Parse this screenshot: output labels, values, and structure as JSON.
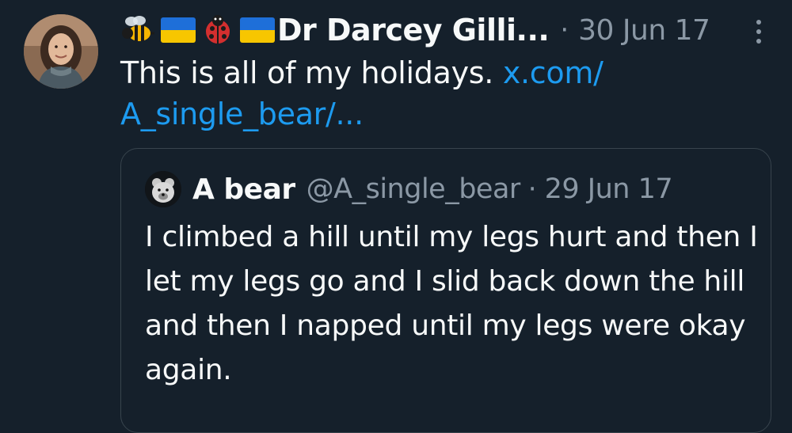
{
  "tweet": {
    "author": {
      "display_name": "Dr Darcey Gilli...",
      "name_emojis": [
        "bee-icon",
        "ukraine-flag-icon",
        "ladybug-icon",
        "ukraine-flag-icon"
      ]
    },
    "separator": "·",
    "timestamp": "30 Jun 17",
    "text": "This is all of my holidays. ",
    "link_text_line1": "x.com/",
    "link_text_line2": "A_single_bear/..."
  },
  "quote": {
    "display_name": "A bear",
    "handle": "@A_single_bear",
    "separator": "·",
    "timestamp": "29 Jun 17",
    "text": "I climbed a hill until my legs hurt and then I let my legs go and I slid back down the hill and then I napped until my legs were okay again."
  },
  "colors": {
    "background": "#15202b",
    "text_primary": "#f7f9f9",
    "text_secondary": "#8b98a5",
    "link": "#1d9bf0",
    "border": "#38444d"
  }
}
